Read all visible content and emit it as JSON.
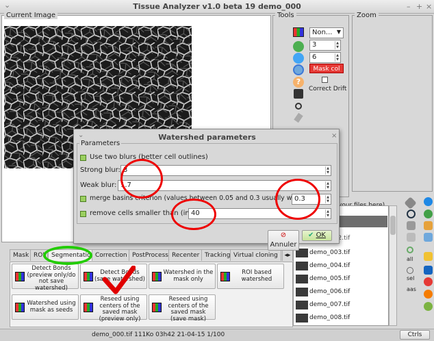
{
  "window": {
    "title": "Tissue Analyzer v1.0 beta 19 demo_000",
    "minimize": "–",
    "maximize": "+",
    "close": "×",
    "menu": "⌄"
  },
  "panels": {
    "current_image": "Current Image",
    "tools": "Tools",
    "zoom": "Zoom"
  },
  "tools": {
    "channel_select": "Non...",
    "value1": "3",
    "value2": "6",
    "mask_col": "Mask col",
    "correct_drift": "Correct Drift"
  },
  "dialog": {
    "title": "Watershed parameters",
    "close": "×",
    "menu": "⌄",
    "group_label": "Parameters",
    "use_two_blurs": "Use two blurs (better cell outlines)",
    "strong_blur_label": "Strong blur:",
    "strong_blur_value": "3",
    "weak_blur_label": "Weak blur:",
    "weak_blur_value": "1.7",
    "merge_label": "merge basins criterion (values between 0.05 and 0.3 usually work well):",
    "merge_value": "0.3",
    "remove_label": "remove cells smaller than (in px):",
    "remove_value": "40",
    "cancel": "Annuler",
    "ok": "OK"
  },
  "tabs": [
    "Mask",
    "ROI",
    "Segmentation",
    "Correction",
    "PostProcess",
    "Recenter",
    "Tracking",
    "Virtual cloning"
  ],
  "active_tab": "Segmentation",
  "seg_buttons": [
    "Detect Bonds (preview only/do not save watershed)",
    "Detect Bonds (save watershed)",
    "Watershed in the mask only",
    "ROI based watershed",
    "Watershed using mask as seeds",
    "Reseed using centers of the saved mask (preview only)",
    "Reseed using centers of the saved mask (save mask)"
  ],
  "file_list": {
    "header": "your files here)",
    "files": [
      "demo_003.tif",
      "demo_004.tif",
      "demo_005.tif",
      "demo_006.tif",
      "demo_007.tif",
      "demo_008.tif"
    ],
    "partial": "demo_002.tif"
  },
  "side_labels": {
    "all": "all",
    "sel": "sel",
    "aas": "aas"
  },
  "status": {
    "text": "demo_000.tif 111Ko 03h42 21-04-15 1/100",
    "ctrls": "Ctrls"
  },
  "colors": {
    "annotation_red": "#e00000",
    "annotation_green": "#22cc00",
    "mask_col": "#e53935"
  },
  "icons": [
    "tv-icon",
    "green-check-icon",
    "blue-check-icon",
    "help-icon",
    "save-icon",
    "radio-icon",
    "pen-icon",
    "search-icon",
    "info-icon",
    "clipboard-icon"
  ]
}
